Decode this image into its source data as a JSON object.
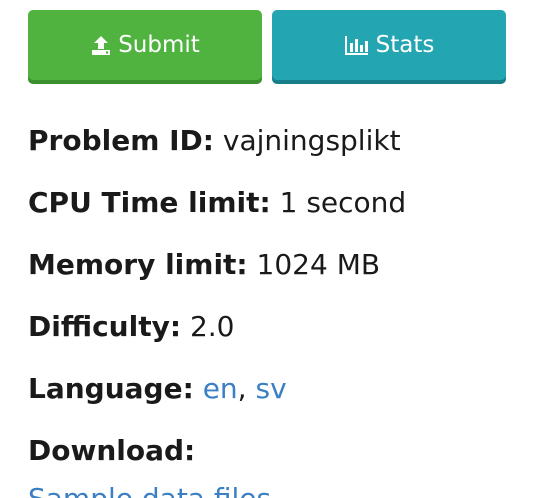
{
  "buttons": {
    "submit_label": "Submit",
    "submit_icon": "upload-icon",
    "submit_color": "#50b33f",
    "stats_label": "Stats",
    "stats_icon": "bar-chart-icon",
    "stats_color": "#23a5b2"
  },
  "meta": {
    "problem_id_key": "Problem ID:",
    "problem_id_value": "vajningsplikt",
    "cpu_key": "CPU Time limit:",
    "cpu_value": "1 second",
    "memory_key": "Memory limit:",
    "memory_value": "1024 MB",
    "difficulty_key": "Difficulty:",
    "difficulty_value": "2.0",
    "language_key": "Language:",
    "languages": [
      "en",
      "sv"
    ],
    "language_separator": ",",
    "download_key": "Download:",
    "download_link": "Sample data files"
  },
  "colors": {
    "link": "#3b7fc4"
  }
}
